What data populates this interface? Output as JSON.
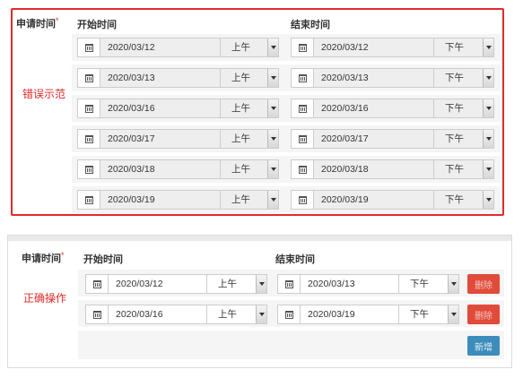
{
  "wrong_example": {
    "apply_label": "申请时间",
    "required_mark": "*",
    "start_header": "开始时间",
    "end_header": "结束时间",
    "note": "错误示范",
    "rows": [
      {
        "start_date": "2020/03/12",
        "start_period": "上午",
        "end_date": "2020/03/12",
        "end_period": "下午"
      },
      {
        "start_date": "2020/03/13",
        "start_period": "上午",
        "end_date": "2020/03/13",
        "end_period": "下午"
      },
      {
        "start_date": "2020/03/16",
        "start_period": "上午",
        "end_date": "2020/03/16",
        "end_period": "下午"
      },
      {
        "start_date": "2020/03/17",
        "start_period": "上午",
        "end_date": "2020/03/17",
        "end_period": "下午"
      },
      {
        "start_date": "2020/03/18",
        "start_period": "上午",
        "end_date": "2020/03/18",
        "end_period": "下午"
      },
      {
        "start_date": "2020/03/19",
        "start_period": "上午",
        "end_date": "2020/03/19",
        "end_period": "下午"
      }
    ]
  },
  "correct_example": {
    "apply_label": "申请时间",
    "required_mark": "*",
    "start_header": "开始时间",
    "end_header": "结束时间",
    "note": "正确操作",
    "delete_label": "删除",
    "add_label": "新增",
    "rows": [
      {
        "start_date": "2020/03/12",
        "start_period": "上午",
        "end_date": "2020/03/13",
        "end_period": "下午"
      },
      {
        "start_date": "2020/03/16",
        "start_period": "上午",
        "end_date": "2020/03/19",
        "end_period": "下午"
      }
    ]
  },
  "icons": {
    "calendar": "calendar-icon",
    "dropdown": "chevron-down-icon"
  },
  "colors": {
    "wrong_border": "#e02b2b",
    "note_text": "#e02b2b",
    "delete_button": "#e04b3a",
    "add_button": "#3c8dbc"
  }
}
